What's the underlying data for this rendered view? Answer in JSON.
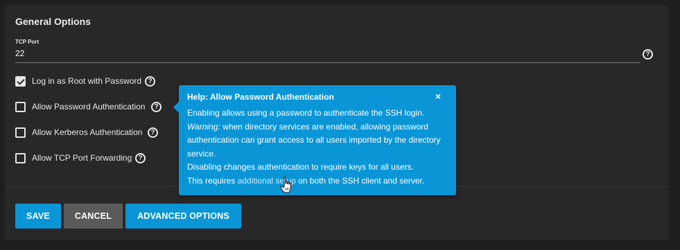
{
  "section": {
    "title": "General Options"
  },
  "tcp_port": {
    "label": "TCP Port",
    "value": "22"
  },
  "checkboxes": [
    {
      "label": "Log in as Root with Password",
      "checked": true
    },
    {
      "label": "Allow Password Authentication",
      "checked": false
    },
    {
      "label": "Allow Kerberos Authentication",
      "checked": false
    },
    {
      "label": "Allow TCP Port Forwarding",
      "checked": false
    }
  ],
  "help_icon_glyph": "?",
  "buttons": {
    "save": "SAVE",
    "cancel": "CANCEL",
    "advanced": "ADVANCED OPTIONS"
  },
  "tooltip": {
    "title": "Help: Allow Password Authentication",
    "close_glyph": "×",
    "line1": "Enabling allows using a password to authenticate the SSH login.",
    "warning_label": "Warning:",
    "warning_text": " when directory services are enabled, allowing password authentication can grant access to all users imported by the directory service.",
    "line3": "Disabling changes authentication to require keys for all users.",
    "line4_pre": "This requires ",
    "link_text": "additional setup",
    "line4_post": " on both the SSH client and server."
  },
  "colors": {
    "accent": "#0a95d6",
    "card_bg": "#282828",
    "page_bg": "#1e1e1e",
    "cancel_bg": "#5a5a5a"
  },
  "icons": [
    "help-circle-icon",
    "check-icon",
    "close-icon",
    "hand-pointer-icon"
  ]
}
